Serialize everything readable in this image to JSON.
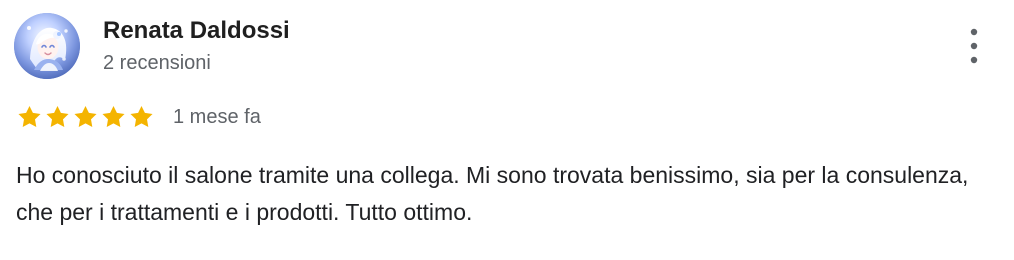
{
  "reviewer": {
    "name": "Renata Daldossi",
    "review_count": "2 recensioni",
    "avatar_icon": "anime-avatar-icon"
  },
  "actions": {
    "more_icon": "more-vertical-icon"
  },
  "review": {
    "rating": 5,
    "rating_max": 5,
    "time_ago": "1 mese fa",
    "text": "Ho conosciuto il salone tramite una collega. Mi sono trovata benissimo, sia per la consulenza, che per i trattamenti e i prodotti. Tutto ottimo."
  },
  "colors": {
    "star": "#f4b400",
    "name": "#1f1f1f",
    "secondary_text": "#5f6368",
    "body_text": "#202124",
    "menu_icon": "#5f6368"
  }
}
